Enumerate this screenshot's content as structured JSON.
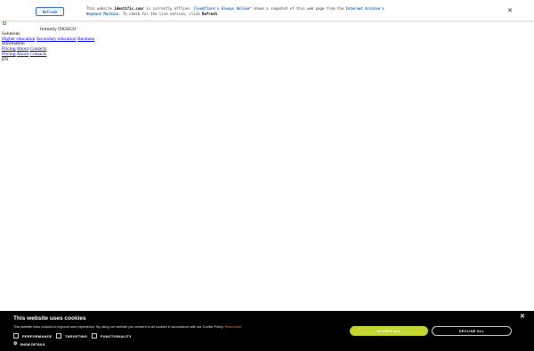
{
  "cf_banner": {
    "refresh_label": "Refresh",
    "msg_1": "This website ",
    "domain": "identific.com/",
    "msg_2": " is currently offline. ",
    "always_online": "Cloudflare's Always Online™",
    "msg_3": " shows a snapshot of this web page from the ",
    "wayback": "Internet Archive's Wayback Machine",
    "msg_4": ". To check for the live version, click ",
    "refresh_word": "Refresh",
    "msg_5": ".",
    "close_glyph": "✕"
  },
  "page": {
    "formerly": "formerly OXSICO",
    "solutions_label": "Solutions",
    "solutions_links": [
      "Higher education",
      "Secondary education",
      "Business"
    ],
    "information_label": "Information",
    "info_links_1": [
      "Pricing",
      "About",
      "Contacts"
    ],
    "info_links_2": [
      "Pricing",
      "About",
      "Contacts"
    ],
    "lang": "EN"
  },
  "cookie": {
    "title": "This website uses cookies",
    "text": "This website uses cookies to improve user experience. By using our website you consent to all cookies in accordance with our Cookie Policy. ",
    "read_more": "Read more",
    "close_glyph": "✕",
    "options": [
      "PERFORMANCE",
      "TARGETING",
      "FUNCTIONALITY"
    ],
    "show_details": "SHOW DETAILS",
    "accept_label": "ACCEPT ALL",
    "decline_label": "DECLINE ALL",
    "accent_color": "#c3d631"
  }
}
